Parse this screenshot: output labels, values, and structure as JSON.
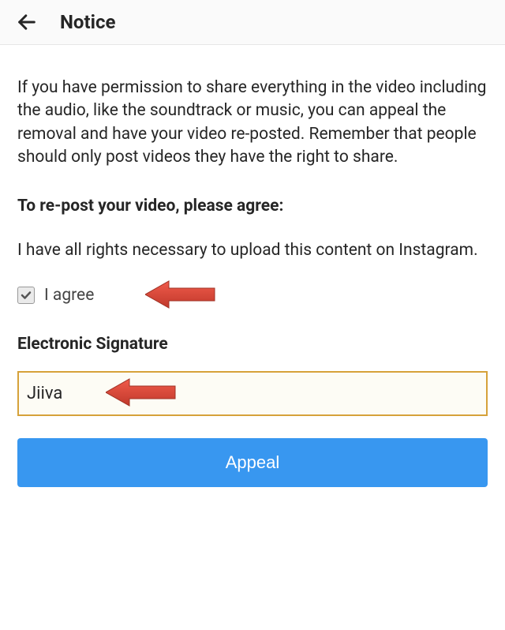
{
  "header": {
    "title": "Notice"
  },
  "body": {
    "permission_text": "If you have permission to share everything in the video including the audio, like the soundtrack or music, you can appeal the removal and have your video re-posted. Remember that people should only post videos they have the right to share.",
    "agree_heading": "To re-post your video, please agree:",
    "rights_text": "I have all rights necessary to upload this content on Instagram.",
    "checkbox_label": "I agree",
    "checkbox_checked": true,
    "signature_label": "Electronic Signature",
    "signature_value": "Jiiva",
    "appeal_button": "Appeal"
  },
  "colors": {
    "accent": "#3897f0",
    "arrow": "#e74c3c"
  }
}
